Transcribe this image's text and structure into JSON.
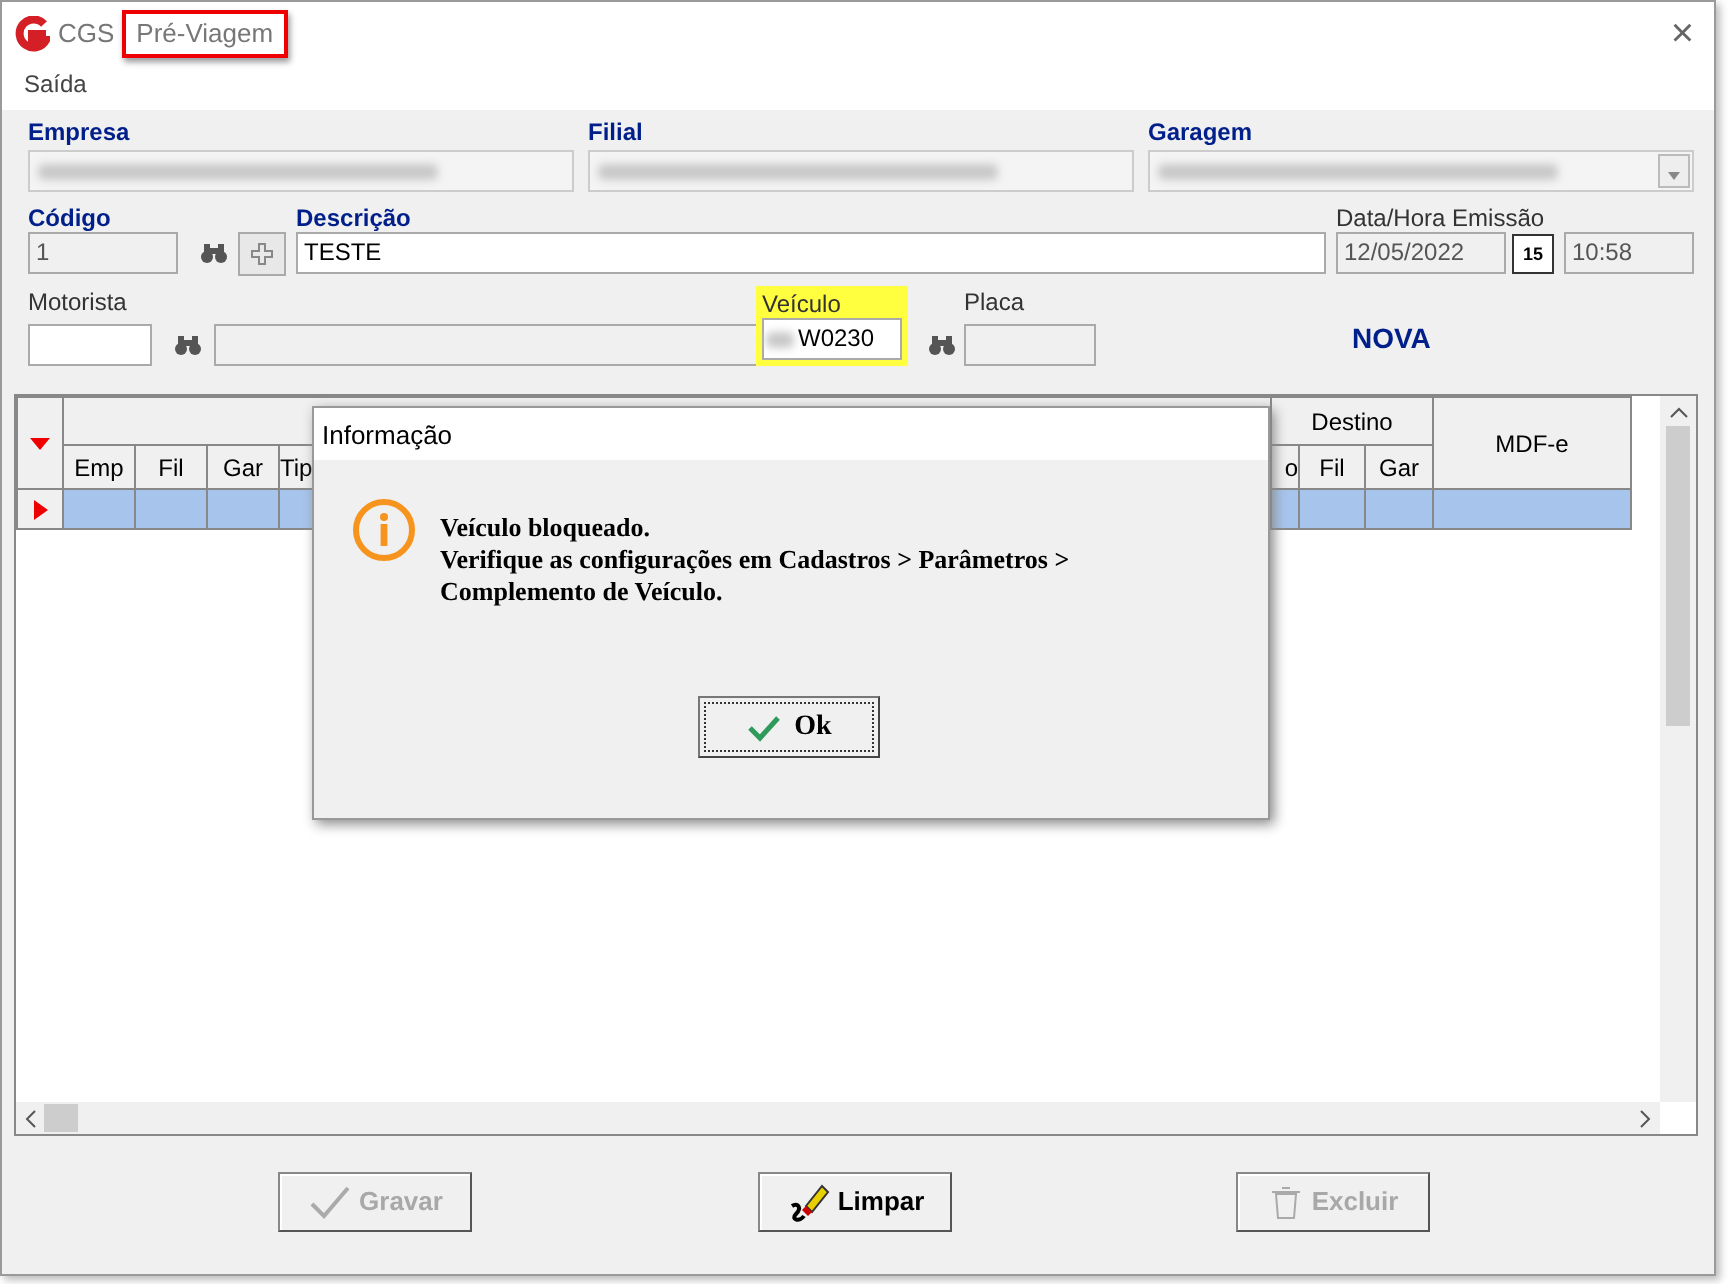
{
  "window": {
    "app": "CGS",
    "title": "Pré-Viagem",
    "title_highlighted": true,
    "close": "×"
  },
  "menu": [
    {
      "label": "Saída"
    }
  ],
  "top_fields": [
    {
      "label": "Empresa",
      "kind": "combo"
    },
    {
      "label": "Filial",
      "kind": "combo"
    },
    {
      "label": "Garagem",
      "kind": "dropdown"
    }
  ],
  "codigo": {
    "label": "Código",
    "value": "1"
  },
  "descricao": {
    "label": "Descrição",
    "value": "TESTE"
  },
  "emissao": {
    "label": "Data/Hora Emissão",
    "date": "12/05/2022",
    "calendar": "15",
    "time": "10:58"
  },
  "motorista": {
    "label": "Motorista"
  },
  "veiculo": {
    "label": "Veículo",
    "value": "W0230",
    "highlighted": true
  },
  "placa": {
    "label": "Placa"
  },
  "status": "NOVA",
  "grid": {
    "columns": [
      {
        "label": "Emp"
      },
      {
        "label": "Fil"
      },
      {
        "label": "Gar"
      },
      {
        "label": "Tip"
      },
      {
        "label": "o"
      },
      {
        "label": "Fil"
      },
      {
        "label": "Gar"
      }
    ],
    "group": "Destino",
    "mdfe": "MDF-e",
    "rows": [
      {
        "selected": true
      }
    ]
  },
  "buttons": [
    {
      "label": "Gravar",
      "kind": "save",
      "disabled": true
    },
    {
      "label": "Limpar",
      "kind": "clear",
      "disabled": false
    },
    {
      "label": "Excluir",
      "kind": "delete",
      "disabled": true
    }
  ],
  "dialog": {
    "title": "Informação",
    "lines": [
      "Veículo bloqueado.",
      "Verifique as configurações em Cadastros > Parâmetros >",
      "Complemento de Veículo."
    ],
    "button": "Ok"
  }
}
